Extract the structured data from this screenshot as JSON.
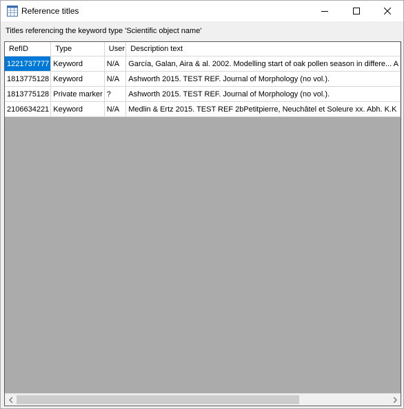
{
  "window": {
    "title": "Reference titles"
  },
  "subtitle": "Titles referencing the keyword type 'Scientific object name'",
  "table": {
    "columns": [
      "RefID",
      "Type",
      "User",
      "Description text"
    ],
    "rows": [
      [
        "1221737777",
        "Keyword",
        "N/A",
        "García, Galan, Aira & al. 2002. Modelling start of oak pollen season in differe... A"
      ],
      [
        "1813775128",
        "Keyword",
        "N/A",
        "Ashworth 2015. TEST REF. Journal of Morphology (no vol.)."
      ],
      [
        "1813775128",
        "Private marker",
        "?",
        "Ashworth 2015. TEST REF. Journal of Morphology (no vol.)."
      ],
      [
        "2106634221",
        "Keyword",
        "N/A",
        "Medlin & Ertz 2015. TEST REF 2bPetitpierre, Neuchâtel et Soleure xx. Abh. K.K"
      ]
    ]
  },
  "colors": {
    "selection": "#0078d7",
    "grid_background": "#ababab"
  }
}
